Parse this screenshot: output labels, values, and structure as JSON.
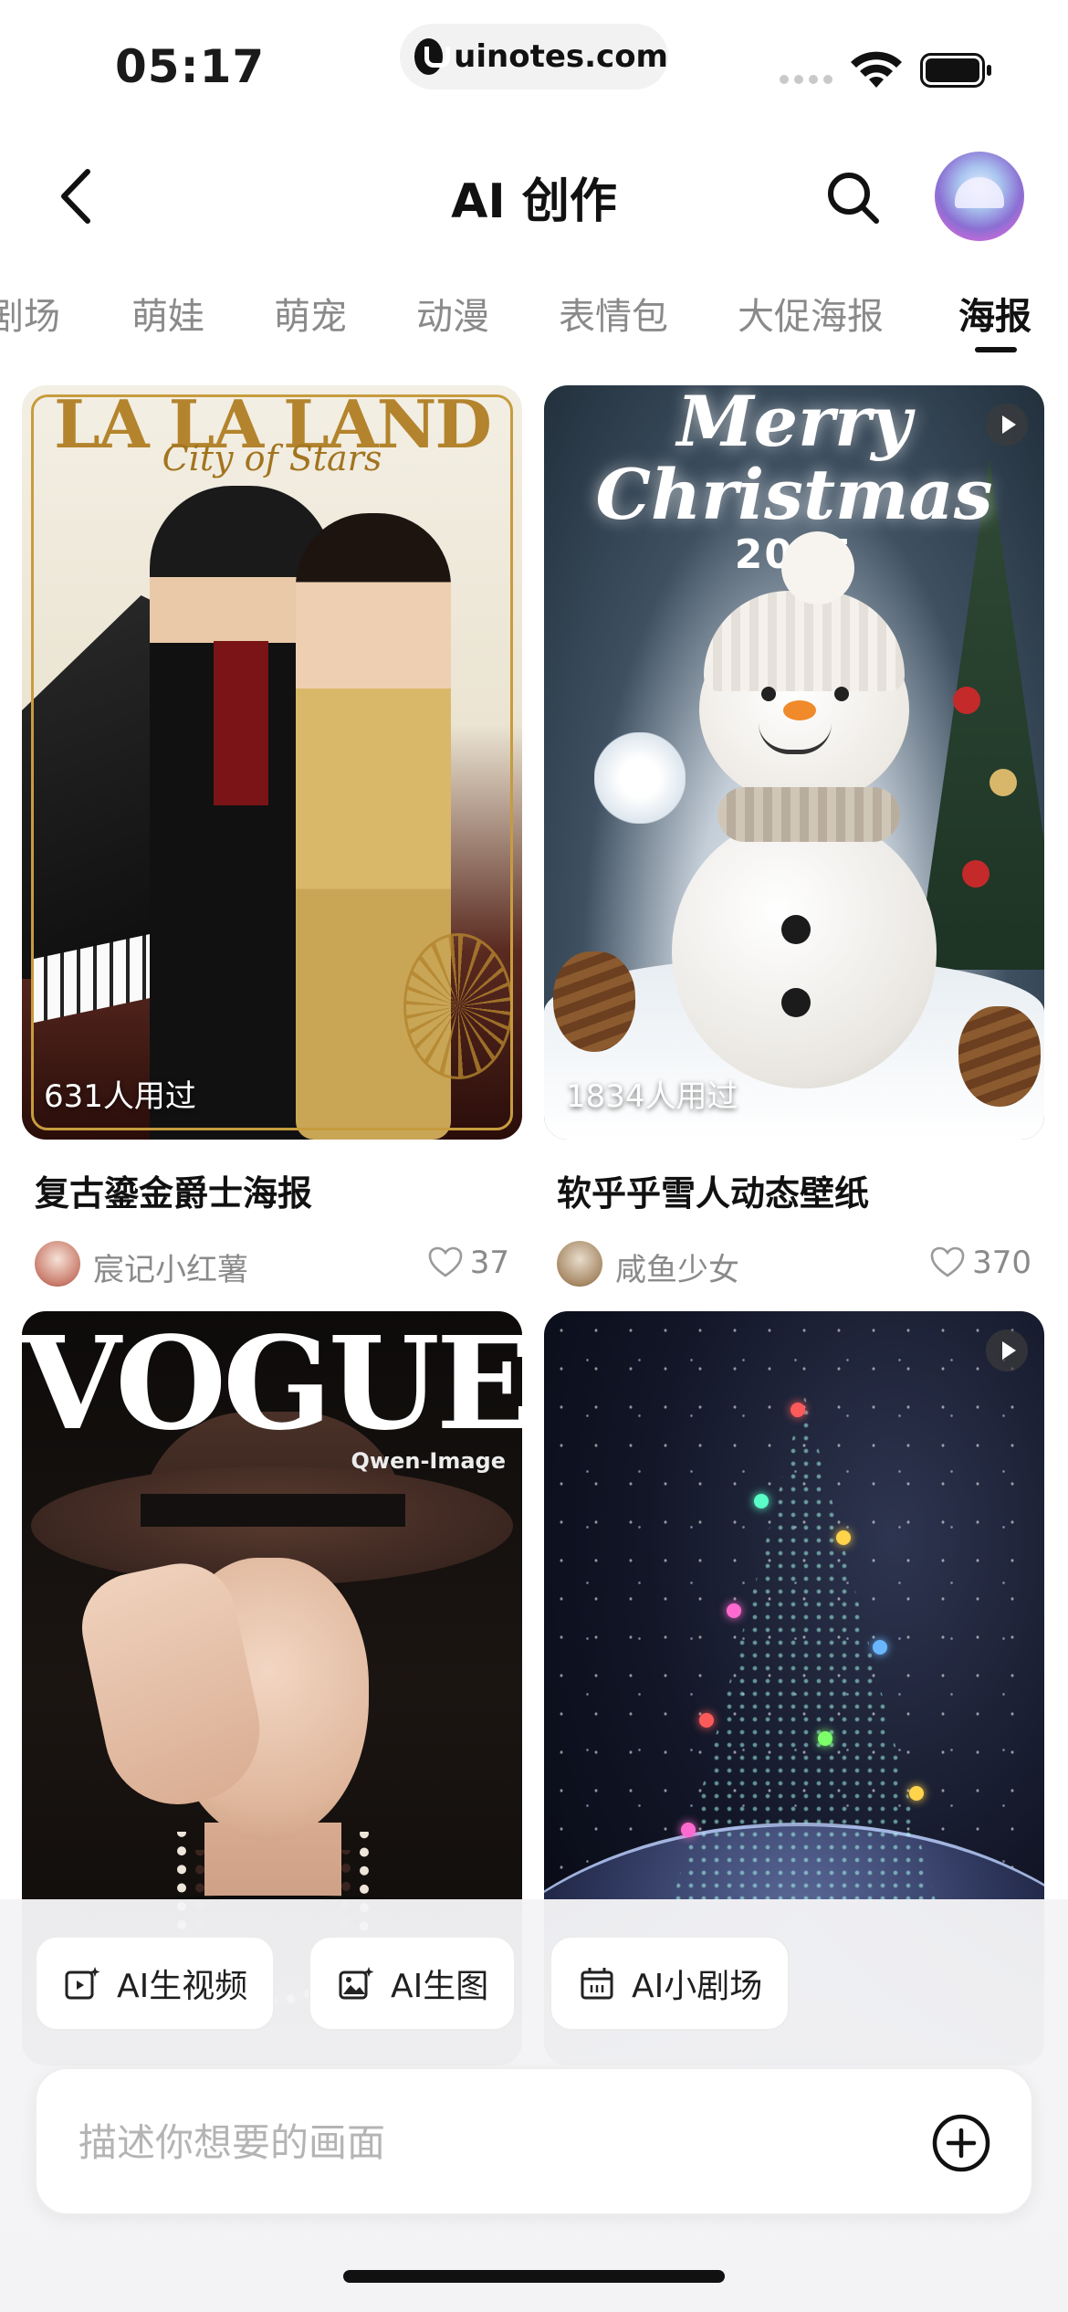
{
  "status_bar": {
    "time": "05:17",
    "url": "uinotes.com",
    "icons": [
      "signal-icon",
      "wifi-icon",
      "battery-icon"
    ]
  },
  "header": {
    "title": "AI 创作",
    "back_icon": "chevron-left-icon",
    "search_icon": "search-icon"
  },
  "tabs": {
    "items": [
      {
        "label": "剧场"
      },
      {
        "label": "萌娃"
      },
      {
        "label": "萌宠"
      },
      {
        "label": "动漫"
      },
      {
        "label": "表情包"
      },
      {
        "label": "大促海报"
      },
      {
        "label": "海报"
      }
    ],
    "active_index": 6
  },
  "cards": [
    {
      "usage": "631人用过",
      "poster_title": "LA LA LAND",
      "poster_subtitle": "City of Stars",
      "title": "复古鎏金爵士海报",
      "author": "宸记小红薯",
      "likes": "37",
      "is_video": false
    },
    {
      "usage": "1834人用过",
      "poster_title": "Merry Christmas",
      "poster_subtitle": "2025",
      "title": "软乎乎雪人动态壁纸",
      "author": "咸鱼少女",
      "likes": "370",
      "is_video": true
    },
    {
      "poster_title": "VOGUE",
      "poster_subtitle": "Qwen-Image",
      "is_video": false
    },
    {
      "is_video": true
    }
  ],
  "bottom": {
    "chips": [
      {
        "label": "AI生视频",
        "icon": "video-sparkle-icon"
      },
      {
        "label": "AI生图",
        "icon": "image-sparkle-icon"
      },
      {
        "label": "AI小剧场",
        "icon": "theater-icon"
      }
    ],
    "prompt_placeholder": "描述你想要的画面",
    "add_icon": "plus-circle-icon"
  },
  "colors": {
    "text_primary": "#111111",
    "text_secondary": "#8a8a8a",
    "background": "#ffffff",
    "sheet_background": "#f3f3f5"
  }
}
